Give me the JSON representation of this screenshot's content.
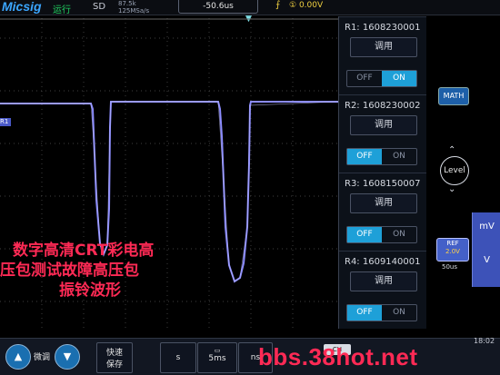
{
  "topbar": {
    "logo": "Micsig",
    "run_status": "运行",
    "storage": "SD",
    "sample_points": "87.5k",
    "sample_rate": "125MSa/s",
    "horizontal_position": "-50.6us",
    "trigger_level": "0.00V"
  },
  "channel_marker": "R1",
  "overlay_text": [
    "数字高清CRT彩电高",
    "压包测试故障高压包",
    "振铃波形"
  ],
  "ref_panel": [
    {
      "label": "R1: 1608230001",
      "button": "调用",
      "off": "OFF",
      "on": "ON",
      "state": "on"
    },
    {
      "label": "R2: 1608230002",
      "button": "调用",
      "off": "OFF",
      "on": "ON",
      "state": "off"
    },
    {
      "label": "R3: 1608150007",
      "button": "调用",
      "off": "OFF",
      "on": "ON",
      "state": "off"
    },
    {
      "label": "R4: 1609140001",
      "button": "调用",
      "off": "OFF",
      "on": "ON",
      "state": "off"
    }
  ],
  "side": {
    "math": "MATH",
    "level": "Level",
    "ref_label": "REF",
    "ref_volt": "2.0V",
    "ref_time": "50us",
    "unit_top": "mV",
    "unit_bottom": "V"
  },
  "bottom": {
    "fine": "微调",
    "quick_save_1": "快速",
    "quick_save_2": "保存",
    "unit_s": "s",
    "unit_ms_value": "5ms",
    "unit_ns": "ns",
    "ch_label": "CH",
    "watermark": "bbs.38hot.net",
    "clock": "18:02"
  },
  "colors": {
    "waveform": "#8c8cff",
    "accent": "#1ea0d8",
    "overlay": "#ff2a55"
  }
}
